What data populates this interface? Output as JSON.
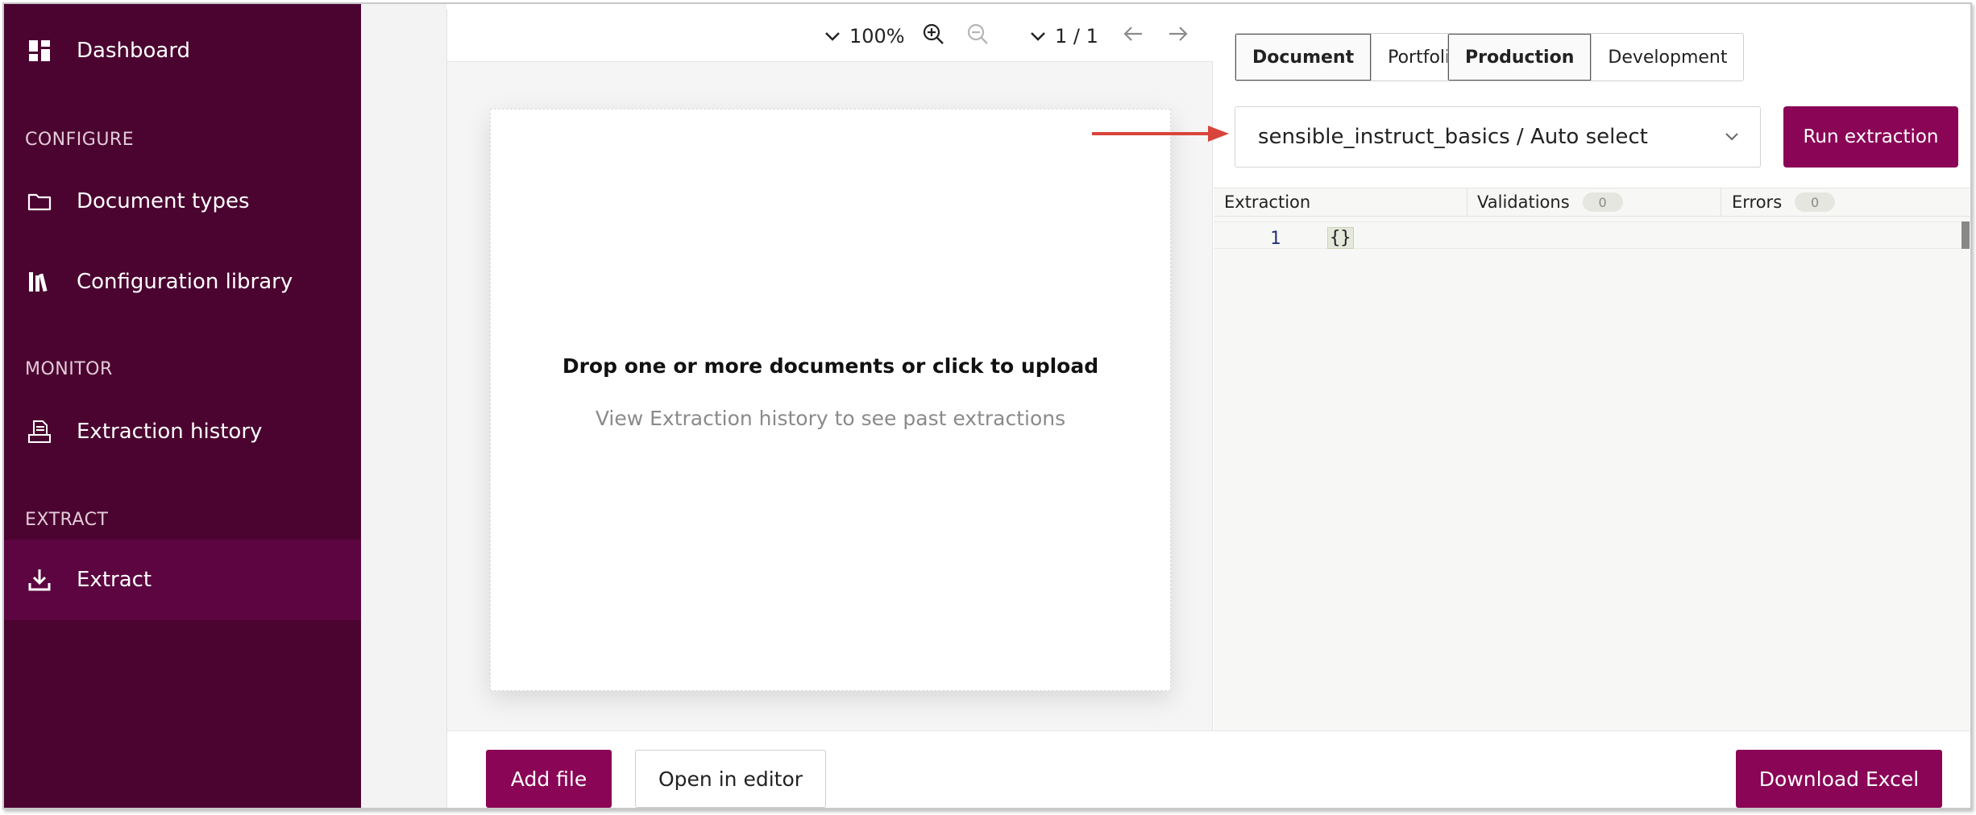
{
  "sidebar": {
    "dashboard_label": "Dashboard",
    "sections": {
      "configure": "CONFIGURE",
      "monitor": "MONITOR",
      "extract": "EXTRACT"
    },
    "items": {
      "document_types": "Document types",
      "configuration_library": "Configuration library",
      "extraction_history": "Extraction history",
      "extract": "Extract"
    },
    "active_item": "Extract"
  },
  "viewer": {
    "zoom": "100%",
    "page_indicator": "1 / 1",
    "dropzone_title": "Drop one or more documents or click to upload",
    "dropzone_subtitle": "View Extraction history to see past extractions"
  },
  "right_pane": {
    "mode_toggle": {
      "document": "Document",
      "portfolio": "Portfolio",
      "selected": "Document"
    },
    "env_toggle": {
      "production": "Production",
      "development": "Development",
      "selected": "Production"
    },
    "config_select_value": "sensible_instruct_basics / Auto select",
    "run_button": "Run extraction",
    "tabs": {
      "extraction": "Extraction",
      "validations": "Validations",
      "validations_count": "0",
      "errors": "Errors",
      "errors_count": "0"
    },
    "editor": {
      "line_number": "1",
      "content": "{}"
    }
  },
  "footer": {
    "add_file": "Add file",
    "open_in_editor": "Open in editor",
    "download_excel": "Download Excel"
  },
  "colors": {
    "sidebar_bg": "#4b0430",
    "sidebar_active_bg": "#5c0540",
    "primary": "#8a0556",
    "annotation_arrow": "#d9443a"
  }
}
